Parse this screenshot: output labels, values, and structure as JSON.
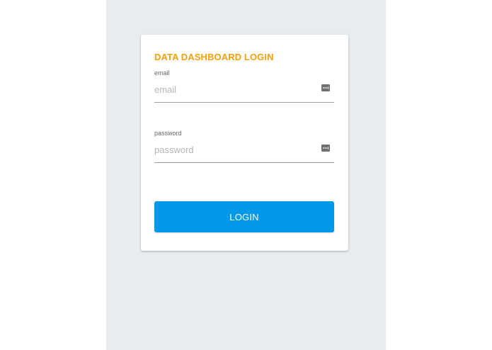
{
  "login_card": {
    "title": "DATA DASHBOARD LOGIN",
    "email": {
      "label": "email",
      "placeholder": "email",
      "value": "",
      "autofill_icon": "password-manager-key-icon"
    },
    "password": {
      "label": "password",
      "placeholder": "password",
      "value": "",
      "autofill_icon": "password-manager-key-icon"
    },
    "login_button_label": "LOGIN"
  },
  "colors": {
    "title": "#f5a00a",
    "button": "#0399e8",
    "background_column": "#e9ecef",
    "underline": "#9e9e9e"
  }
}
